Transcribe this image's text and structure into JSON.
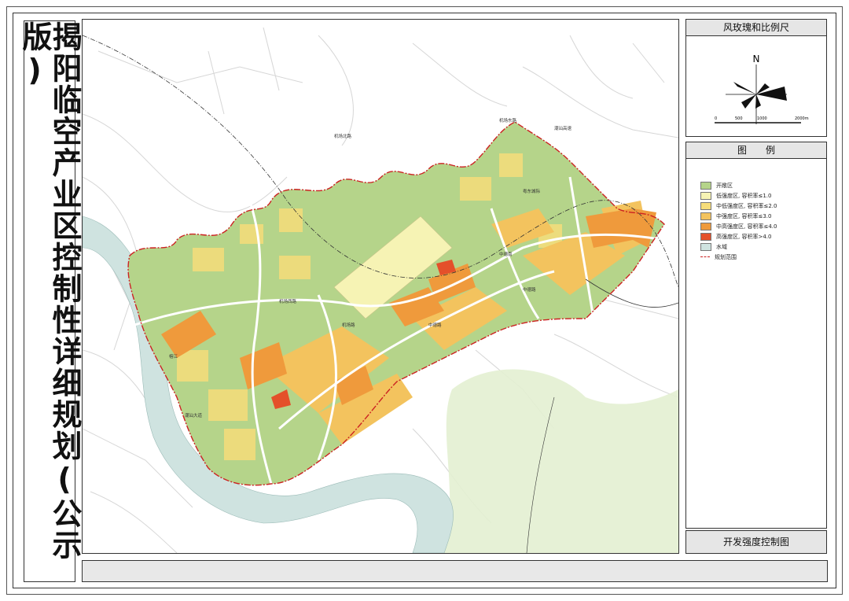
{
  "title": "揭阳临空产业区控制性详细规划(公示版)",
  "compass": {
    "heading": "风玫瑰和比例尺",
    "north": "N",
    "scale_ticks": [
      "0",
      "500",
      "1000",
      "2000m"
    ]
  },
  "legend": {
    "heading": "图　　例",
    "items": [
      {
        "label": "开敞区",
        "color": "#b5d48a"
      },
      {
        "label": "低强度区, 容积率≤1.0",
        "color": "#f6f3b4"
      },
      {
        "label": "中低强度区, 容积率≤2.0",
        "color": "#f6dd7a"
      },
      {
        "label": "中强度区, 容积率≤3.0",
        "color": "#f3c35e"
      },
      {
        "label": "中高强度区, 容积率≤4.0",
        "color": "#ef9a3c"
      },
      {
        "label": "高强度区, 容积率>4.0",
        "color": "#e4502a"
      },
      {
        "label": "水域",
        "color": "#cfe3e0"
      },
      {
        "label": "规划范围",
        "color": "#cc2222"
      }
    ]
  },
  "drawing_title": "开发强度控制图",
  "map_labels": [
    "机场东路",
    "机场北路",
    "粤东城际",
    "潮汕高速",
    "中德南",
    "中德路",
    "机场西路",
    "榕江",
    "潮汕大道",
    "中德路",
    "机场路"
  ]
}
